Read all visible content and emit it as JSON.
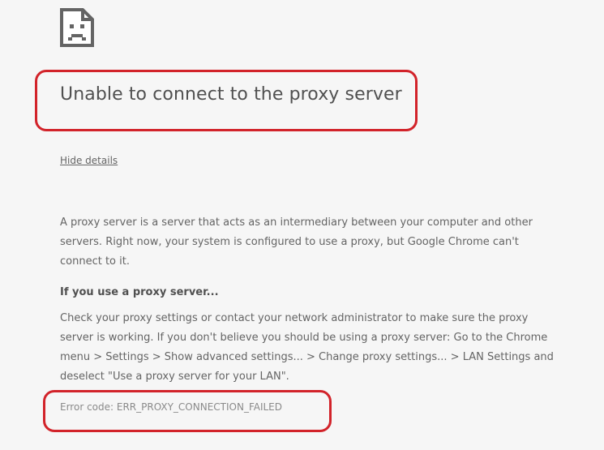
{
  "icon": "sad-page-icon",
  "title": "Unable to connect to the proxy server",
  "details_toggle_label": "Hide details",
  "explanation": "A proxy server is a server that acts as an intermediary between your computer and other servers. Right now, your system is configured to use a proxy, but Google Chrome can't connect to it.",
  "proxy_section": {
    "heading": "If you use a proxy server...",
    "body": "Check your proxy settings or contact your network administrator to make sure the proxy server is working. If you don't believe you should be using a proxy server: Go to the Chrome menu > Settings > Show advanced settings... > Change proxy settings... > LAN Settings and deselect \"Use a proxy server for your LAN\"."
  },
  "error_code": "Error code: ERR_PROXY_CONNECTION_FAILED",
  "colors": {
    "annotation": "#d2232a",
    "background": "#f6f6f6",
    "text": "#646464"
  }
}
